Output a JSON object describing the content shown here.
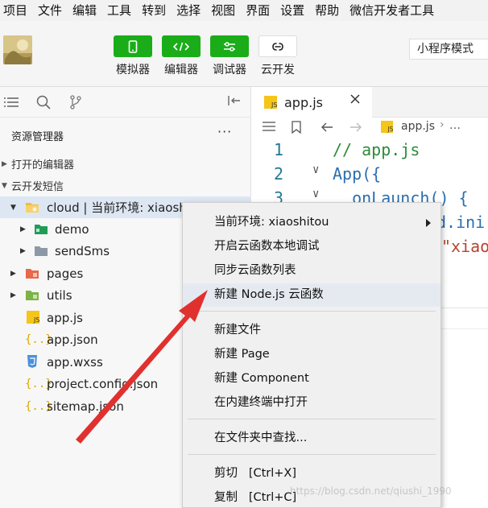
{
  "menubar": [
    "项目",
    "文件",
    "编辑",
    "工具",
    "转到",
    "选择",
    "视图",
    "界面",
    "设置",
    "帮助",
    "微信开发者工具"
  ],
  "toolbar": {
    "simulator": "模拟器",
    "editor": "编辑器",
    "debugger": "调试器",
    "cloud": "云开发",
    "mode": "小程序模式"
  },
  "sidebar": {
    "explorer_title": "资源管理器",
    "more": "···",
    "open_editors": "打开的编辑器",
    "project": "云开发短信",
    "tree": [
      {
        "label": "cloud | 当前环境: xiaoshitou"
      },
      {
        "label": "demo"
      },
      {
        "label": "sendSms"
      },
      {
        "label": "pages"
      },
      {
        "label": "utils"
      },
      {
        "label": "app.js"
      },
      {
        "label": "app.json"
      },
      {
        "label": "app.wxss"
      },
      {
        "label": "project.config.json"
      },
      {
        "label": "sitemap.json"
      }
    ]
  },
  "editor": {
    "tab": "app.js",
    "breadcrumb": "app.js",
    "breadcrumb_more": "…",
    "lines": [
      {
        "num": "1",
        "text": "// app.js"
      },
      {
        "num": "2",
        "text": "App({"
      },
      {
        "num": "3",
        "text": "  onLaunch() {"
      }
    ],
    "peek_line_4": "d.ini",
    "peek_line_5": "\"xiao"
  },
  "context_menu": {
    "items": [
      "当前环境: xiaoshitou",
      "开启云函数本地调试",
      "同步云函数列表",
      "新建 Node.js 云函数",
      "新建文件",
      "新建 Page",
      "新建 Component",
      "在内建终端中打开",
      "在文件夹中查找...",
      "剪切   [Ctrl+X]",
      "复制   [Ctrl+C]"
    ]
  },
  "watermark": "https://blog.csdn.net/qiushi_1990",
  "colors": {
    "accent_green": "#1aad19",
    "selection": "#dde7f3",
    "arrow": "#e0312f"
  }
}
